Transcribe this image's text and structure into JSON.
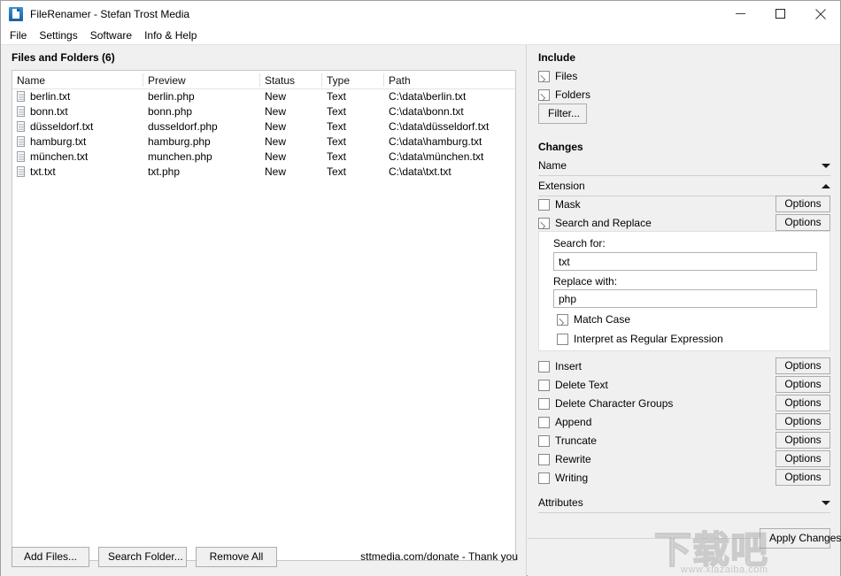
{
  "window": {
    "title": "FileRenamer - Stefan Trost Media",
    "icon": "document-app-icon",
    "controls": {
      "minimize": "minimize-icon",
      "maximize": "maximize-icon",
      "close": "close-icon"
    }
  },
  "menubar": {
    "items": [
      {
        "label": "File"
      },
      {
        "label": "Settings"
      },
      {
        "label": "Software"
      },
      {
        "label": "Info & Help"
      }
    ]
  },
  "left": {
    "title": "Files and Folders (6)",
    "columns": [
      "Name",
      "Preview",
      "Status",
      "Type",
      "Path"
    ],
    "rows": [
      {
        "name": "berlin.txt",
        "preview": "berlin.php",
        "status": "New",
        "type": "Text",
        "path": "C:\\data\\berlin.txt"
      },
      {
        "name": "bonn.txt",
        "preview": "bonn.php",
        "status": "New",
        "type": "Text",
        "path": "C:\\data\\bonn.txt"
      },
      {
        "name": "düsseldorf.txt",
        "preview": "dusseldorf.php",
        "status": "New",
        "type": "Text",
        "path": "C:\\data\\düsseldorf.txt"
      },
      {
        "name": "hamburg.txt",
        "preview": "hamburg.php",
        "status": "New",
        "type": "Text",
        "path": "C:\\data\\hamburg.txt"
      },
      {
        "name": "münchen.txt",
        "preview": "munchen.php",
        "status": "New",
        "type": "Text",
        "path": "C:\\data\\münchen.txt"
      },
      {
        "name": "txt.txt",
        "preview": "txt.php",
        "status": "New",
        "type": "Text",
        "path": "C:\\data\\txt.txt"
      }
    ],
    "buttons": {
      "add_files": "Add Files...",
      "search_folder": "Search Folder...",
      "remove_all": "Remove All"
    },
    "donate": "sttmedia.com/donate - Thank you"
  },
  "right": {
    "include": {
      "title": "Include",
      "files": {
        "label": "Files",
        "checked": true
      },
      "folders": {
        "label": "Folders",
        "checked": true
      },
      "filter_button": "Filter..."
    },
    "changes": {
      "title": "Changes",
      "name_group": {
        "label": "Name",
        "expanded": false,
        "chevron": "chevron-down-icon"
      },
      "extension_group": {
        "label": "Extension",
        "expanded": true,
        "chevron": "chevron-up-icon"
      },
      "options_label": "Options",
      "mask": {
        "label": "Mask",
        "checked": false
      },
      "search_and_replace": {
        "label": "Search and Replace",
        "checked": true
      },
      "search_replace_panel": {
        "search_for_label": "Search for:",
        "search_for_value": "txt",
        "search_for_placeholder": "",
        "replace_with_label": "Replace with:",
        "replace_with_value": "php",
        "replace_with_placeholder": "",
        "match_case": {
          "label": "Match Case",
          "checked": true
        },
        "regex": {
          "label": "Interpret as Regular Expression",
          "checked": false
        }
      },
      "more_options": [
        {
          "label": "Insert",
          "checked": false
        },
        {
          "label": "Delete Text",
          "checked": false
        },
        {
          "label": "Delete Character Groups",
          "checked": false
        },
        {
          "label": "Append",
          "checked": false
        },
        {
          "label": "Truncate",
          "checked": false
        },
        {
          "label": "Rewrite",
          "checked": false
        },
        {
          "label": "Writing",
          "checked": false
        }
      ],
      "attributes_group": {
        "label": "Attributes",
        "expanded": false,
        "chevron": "chevron-down-icon"
      }
    },
    "apply_button": "Apply Changes"
  },
  "watermark": {
    "text_cn": "下载吧",
    "url": "www.xiazaiba.com"
  },
  "colors": {
    "window_bg": "#f0f0f0",
    "panel_white": "#ffffff",
    "border": "#c8c8c8",
    "accent": "#1560a8",
    "text": "#000000"
  }
}
